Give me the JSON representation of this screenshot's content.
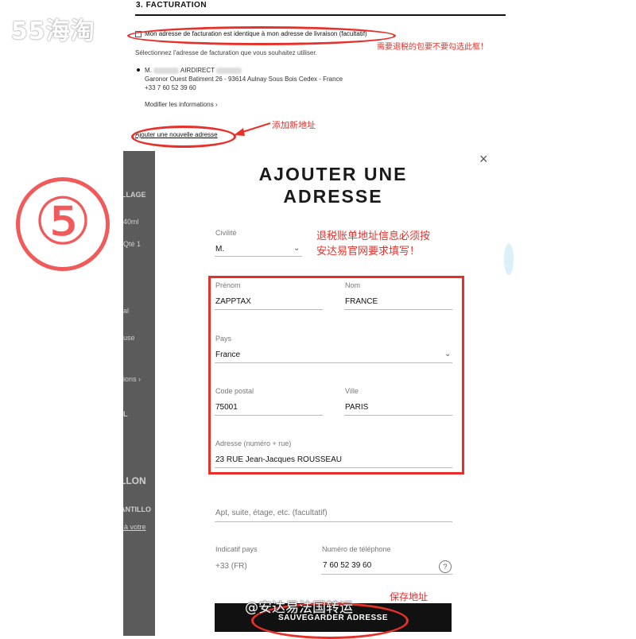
{
  "watermark": "55海淘",
  "section": {
    "title": "3. FACTURATION",
    "same_address_checkbox": "Mon adresse de facturation est identique à mon adresse de livraison (facultatif)",
    "select_hint": "Sélectionnez l'adresse de facturation que vous souhaitez utiliser.",
    "address": {
      "name_prefix": "M.",
      "name_suffix": "AIRDIRECT",
      "line1": "Garonor Ouest Batiment 26 - 93614 Aulnay Sous Bois Cedex - France",
      "phone": "+33 7 60 52 39 60"
    },
    "modify_link": "Modifier les informations ›",
    "add_address_link": "Ajouter une nouvelle adresse"
  },
  "annotations": {
    "note_checkbox": "需要退税的包要不要勾选此框！",
    "note_add": "添加新地址",
    "note_required": [
      "退税账单地址信息必须按",
      "安达易官网要求填写！"
    ],
    "note_save": "保存地址",
    "step_number": "⑤",
    "bottom_watermark": "@安达易法国转运"
  },
  "background_fragments": [
    "LLAGE",
    "40ml",
    "Qté 1",
    "al",
    "use",
    "ions ›",
    "L",
    "LLON",
    "ANTILLO",
    "t à votre"
  ],
  "modal": {
    "title_line1": "AJOUTER UNE",
    "title_line2": "ADRESSE",
    "close_icon": "×",
    "civilite": {
      "label": "Civilité",
      "value": "M."
    },
    "prenom": {
      "label": "Prénom",
      "value": "ZAPPTAX"
    },
    "nom": {
      "label": "Nom",
      "value": "FRANCE"
    },
    "pays": {
      "label": "Pays",
      "value": "France"
    },
    "code_postal": {
      "label": "Code postal",
      "value": "75001"
    },
    "ville": {
      "label": "Ville",
      "value": "PARIS"
    },
    "adresse": {
      "label": "Adresse (numéro + rue)",
      "value": "23 RUE Jean-Jacques ROUSSEAU"
    },
    "apt": {
      "placeholder": "Apt, suite, étage, etc. (facultatif)"
    },
    "indicatif": {
      "label": "Indicatif pays",
      "value": "+33 (FR)"
    },
    "telephone": {
      "label": "Numéro de téléphone",
      "value": "7 60 52 39 60"
    },
    "help_icon": "?",
    "save_button": "SAUVEGARDER ADRESSE"
  },
  "colors": {
    "annotation_red": "#e8302a",
    "button_black": "#111111"
  }
}
